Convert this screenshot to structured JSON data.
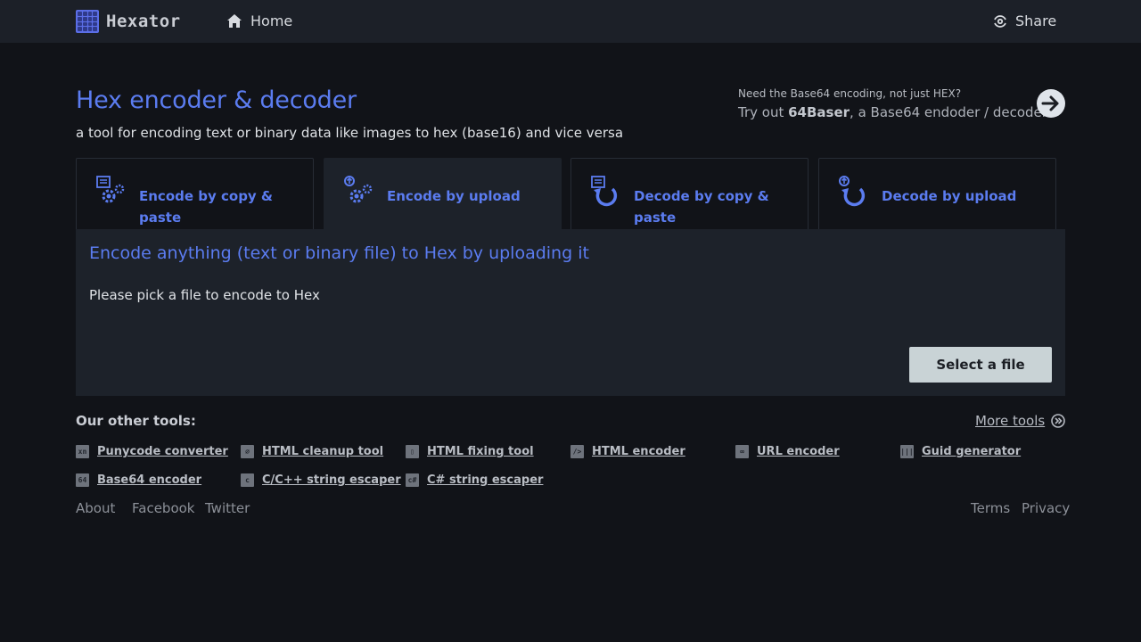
{
  "header": {
    "brand": "Hexator",
    "home_label": "Home",
    "share_label": "Share"
  },
  "hero": {
    "title": "Hex encoder & decoder",
    "subtitle": "a tool for encoding text or binary data like images to hex (base16) and vice versa"
  },
  "promo": {
    "line1": "Need the Base64 encoding, not just HEX?",
    "line2_prefix": "Try out ",
    "line2_bold": "64Baser",
    "line2_suffix": ", a Base64 endoder / decoder"
  },
  "tabs": [
    {
      "label": "Encode by copy & paste",
      "active": false
    },
    {
      "label": "Encode by upload",
      "active": true
    },
    {
      "label": "Decode by copy & paste",
      "active": false
    },
    {
      "label": "Decode by upload",
      "active": false
    }
  ],
  "panel": {
    "title": "Encode anything (text or binary file) to Hex by uploading it",
    "text": "Please pick a file to encode to Hex",
    "button": "Select a file"
  },
  "other_tools": {
    "title": "Our other tools:",
    "more_label": "More tools",
    "items": [
      {
        "label": "Punycode converter",
        "icon": "xn"
      },
      {
        "label": "HTML cleanup tool",
        "icon": "⌀"
      },
      {
        "label": "HTML fixing tool",
        "icon": "▯"
      },
      {
        "label": "HTML encoder",
        "icon": "/>"
      },
      {
        "label": "URL encoder",
        "icon": "∞"
      },
      {
        "label": "Guid generator",
        "icon": "|||"
      },
      {
        "label": "Base64 encoder",
        "icon": "64"
      },
      {
        "label": "C/C++ string escaper",
        "icon": "c"
      },
      {
        "label": "C# string escaper",
        "icon": "c#"
      }
    ]
  },
  "footer": {
    "about": "About",
    "facebook": "Facebook",
    "twitter": "Twitter",
    "terms": "Terms",
    "privacy": "Privacy"
  },
  "colors": {
    "accent": "#5b7cf0",
    "background": "#111318",
    "panel": "#1d222a"
  }
}
